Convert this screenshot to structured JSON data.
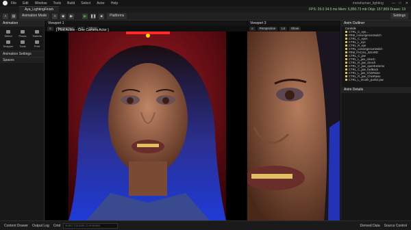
{
  "menu": {
    "items": [
      "File",
      "Edit",
      "Window",
      "Tools",
      "Build",
      "Select",
      "Actor",
      "Help"
    ],
    "project": "metahuman_lighting"
  },
  "title_tab": "Aya_LightingFinish",
  "stats": "FPS: 29.0  34.5 ms  Mem: 5,850.73 mb  Objs: 157,809  Draws: 19",
  "toolbar": {
    "mode": "Animation Mode",
    "platforms": "Platforms",
    "settings": "Settings"
  },
  "left_panel": {
    "header": "Animation",
    "tools": [
      "Select",
      "Poses",
      "Tweens",
      "Snapper",
      "Tools",
      "Print"
    ],
    "section1": "Animation Settings",
    "section2": "Spaces"
  },
  "viewport1": {
    "tab": "Viewport 1",
    "perspective": "Perspective",
    "lit": "Lit",
    "show": "Show",
    "pilot": "[ Pilot Active - Cine Camera Actor ]"
  },
  "viewport2": {
    "tab": "Viewport 3",
    "perspective": "Perspective",
    "lit": "Lit",
    "show": "Show"
  },
  "outliner": {
    "header": "Anim Outliner",
    "sub": "Controls",
    "items": [
      "CTRL_C_eye...",
      "FRM_convergenceSwitch",
      "CTRL_C_eyes",
      "CTRL_L_eye",
      "CTRL_R_eye",
      "CTRL_convergenceSwitch",
      "FRM_FACIAL_BOARD",
      "CTRL_C_jaw",
      "CTRL_L_jaw_clench",
      "CTRL_R_jaw_clench",
      "CTRL_C_jaw_openExtreme",
      "CTRL_C_jaw_fwdBack",
      "CTRL_L_jaw_ChinRaise",
      "CTRL_R_jaw_ChinRaise",
      "CTRL_L_mouth_push2.jaw"
    ],
    "details": "Anim Details"
  },
  "bottom": {
    "content_drawer": "Content Drawer",
    "output_log": "Output Log",
    "cmd": "Cmd",
    "cmd_placeholder": "Enter Console Command",
    "derived": "Derived Data",
    "source": "Source Control"
  }
}
